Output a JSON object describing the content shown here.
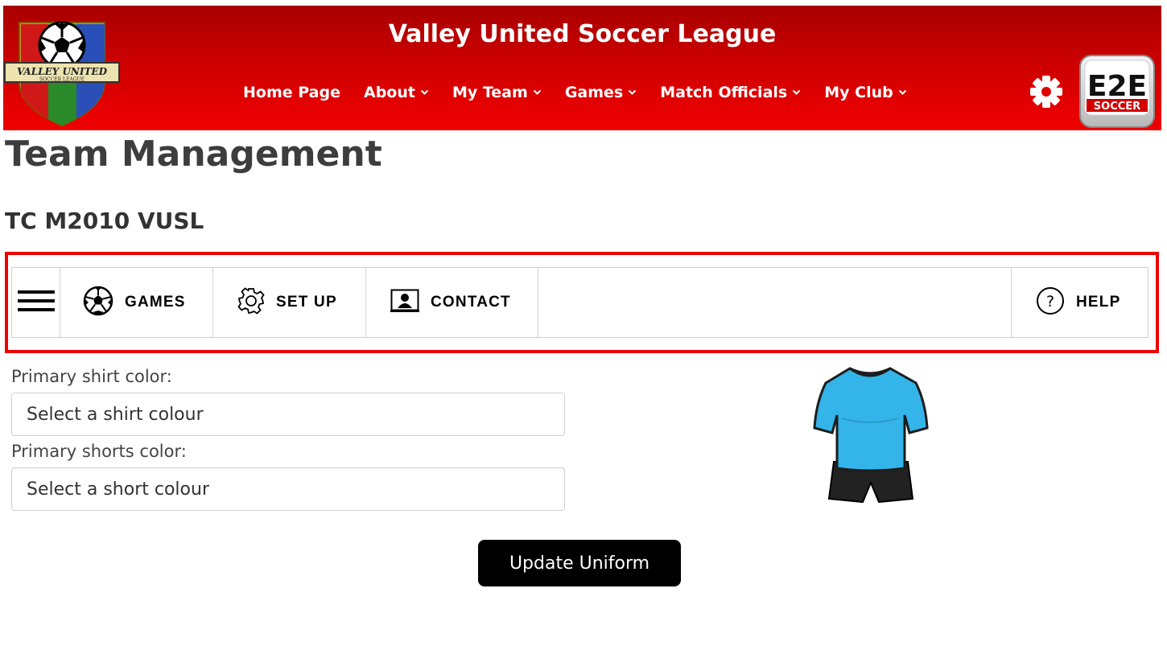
{
  "header": {
    "site_title": "Valley United Soccer League",
    "logo_text_top": "VALLEY UNITED",
    "logo_text_bottom": "SOCCER LEAGUE",
    "e2e_logo_text": "E2E",
    "e2e_logo_sub": "SOCCER",
    "background_colors": [
      "#a80000",
      "#f00000"
    ]
  },
  "nav": {
    "items": [
      {
        "label": "Home Page",
        "has_dropdown": false
      },
      {
        "label": "About",
        "has_dropdown": true
      },
      {
        "label": "My Team",
        "has_dropdown": true
      },
      {
        "label": "Games",
        "has_dropdown": true
      },
      {
        "label": "Match Officials",
        "has_dropdown": true
      },
      {
        "label": "My Club",
        "has_dropdown": true
      }
    ],
    "chevron": "⌄",
    "settings_icon": "gear-icon"
  },
  "page": {
    "title": "Team Management",
    "team_name": "TC M2010 VUSL"
  },
  "toolbar": {
    "highlight_color": "#ee0000",
    "menu_icon": "hamburger-icon",
    "games_label": "GAMES",
    "setup_label": "SET UP",
    "contact_label": "CONTACT",
    "help_label": "HELP"
  },
  "form": {
    "shirt_label": "Primary shirt color:",
    "shirt_placeholder": "Select a shirt colour",
    "shorts_label": "Primary shorts color:",
    "shorts_placeholder": "Select a short colour",
    "submit_label": "Update Uniform",
    "preview_shirt_color": "#33b5ea",
    "preview_shorts_color": "#222222"
  }
}
